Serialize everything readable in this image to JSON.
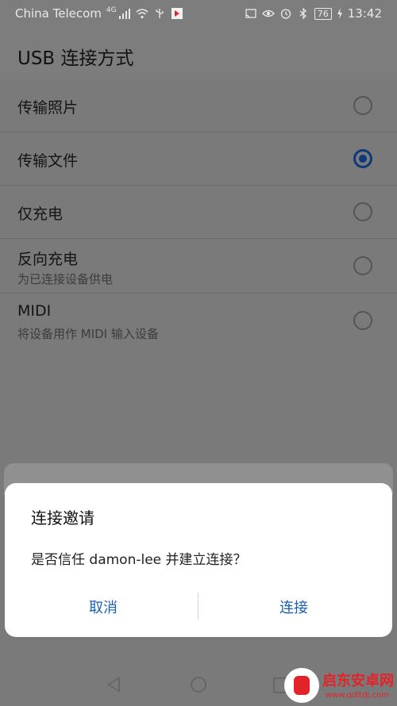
{
  "status_bar": {
    "carrier": "China Telecom",
    "network": "4G",
    "battery": "76",
    "time": "13:42"
  },
  "header": {
    "title": "USB 连接方式"
  },
  "options": [
    {
      "label": "传输照片",
      "sub": "",
      "selected": false
    },
    {
      "label": "传输文件",
      "sub": "",
      "selected": true
    },
    {
      "label": "仅充电",
      "sub": "",
      "selected": false
    },
    {
      "label": "反向充电",
      "sub": "为已连接设备供电",
      "selected": false
    },
    {
      "label": "MIDI",
      "sub": "将设备用作 MIDI 输入设备",
      "selected": false
    }
  ],
  "dialog": {
    "title": "连接邀请",
    "message": "是否信任 damon-lee 并建立连接？",
    "cancel_label": "取消",
    "confirm_label": "连接"
  },
  "watermark": {
    "name": "启东安卓网",
    "url": "www.qdltdj.com"
  },
  "colors": {
    "accent": "#1b5fb5",
    "radio_selected": "#0b3a7a",
    "overlay": "#7a7a7a",
    "watermark": "#e2232a"
  }
}
